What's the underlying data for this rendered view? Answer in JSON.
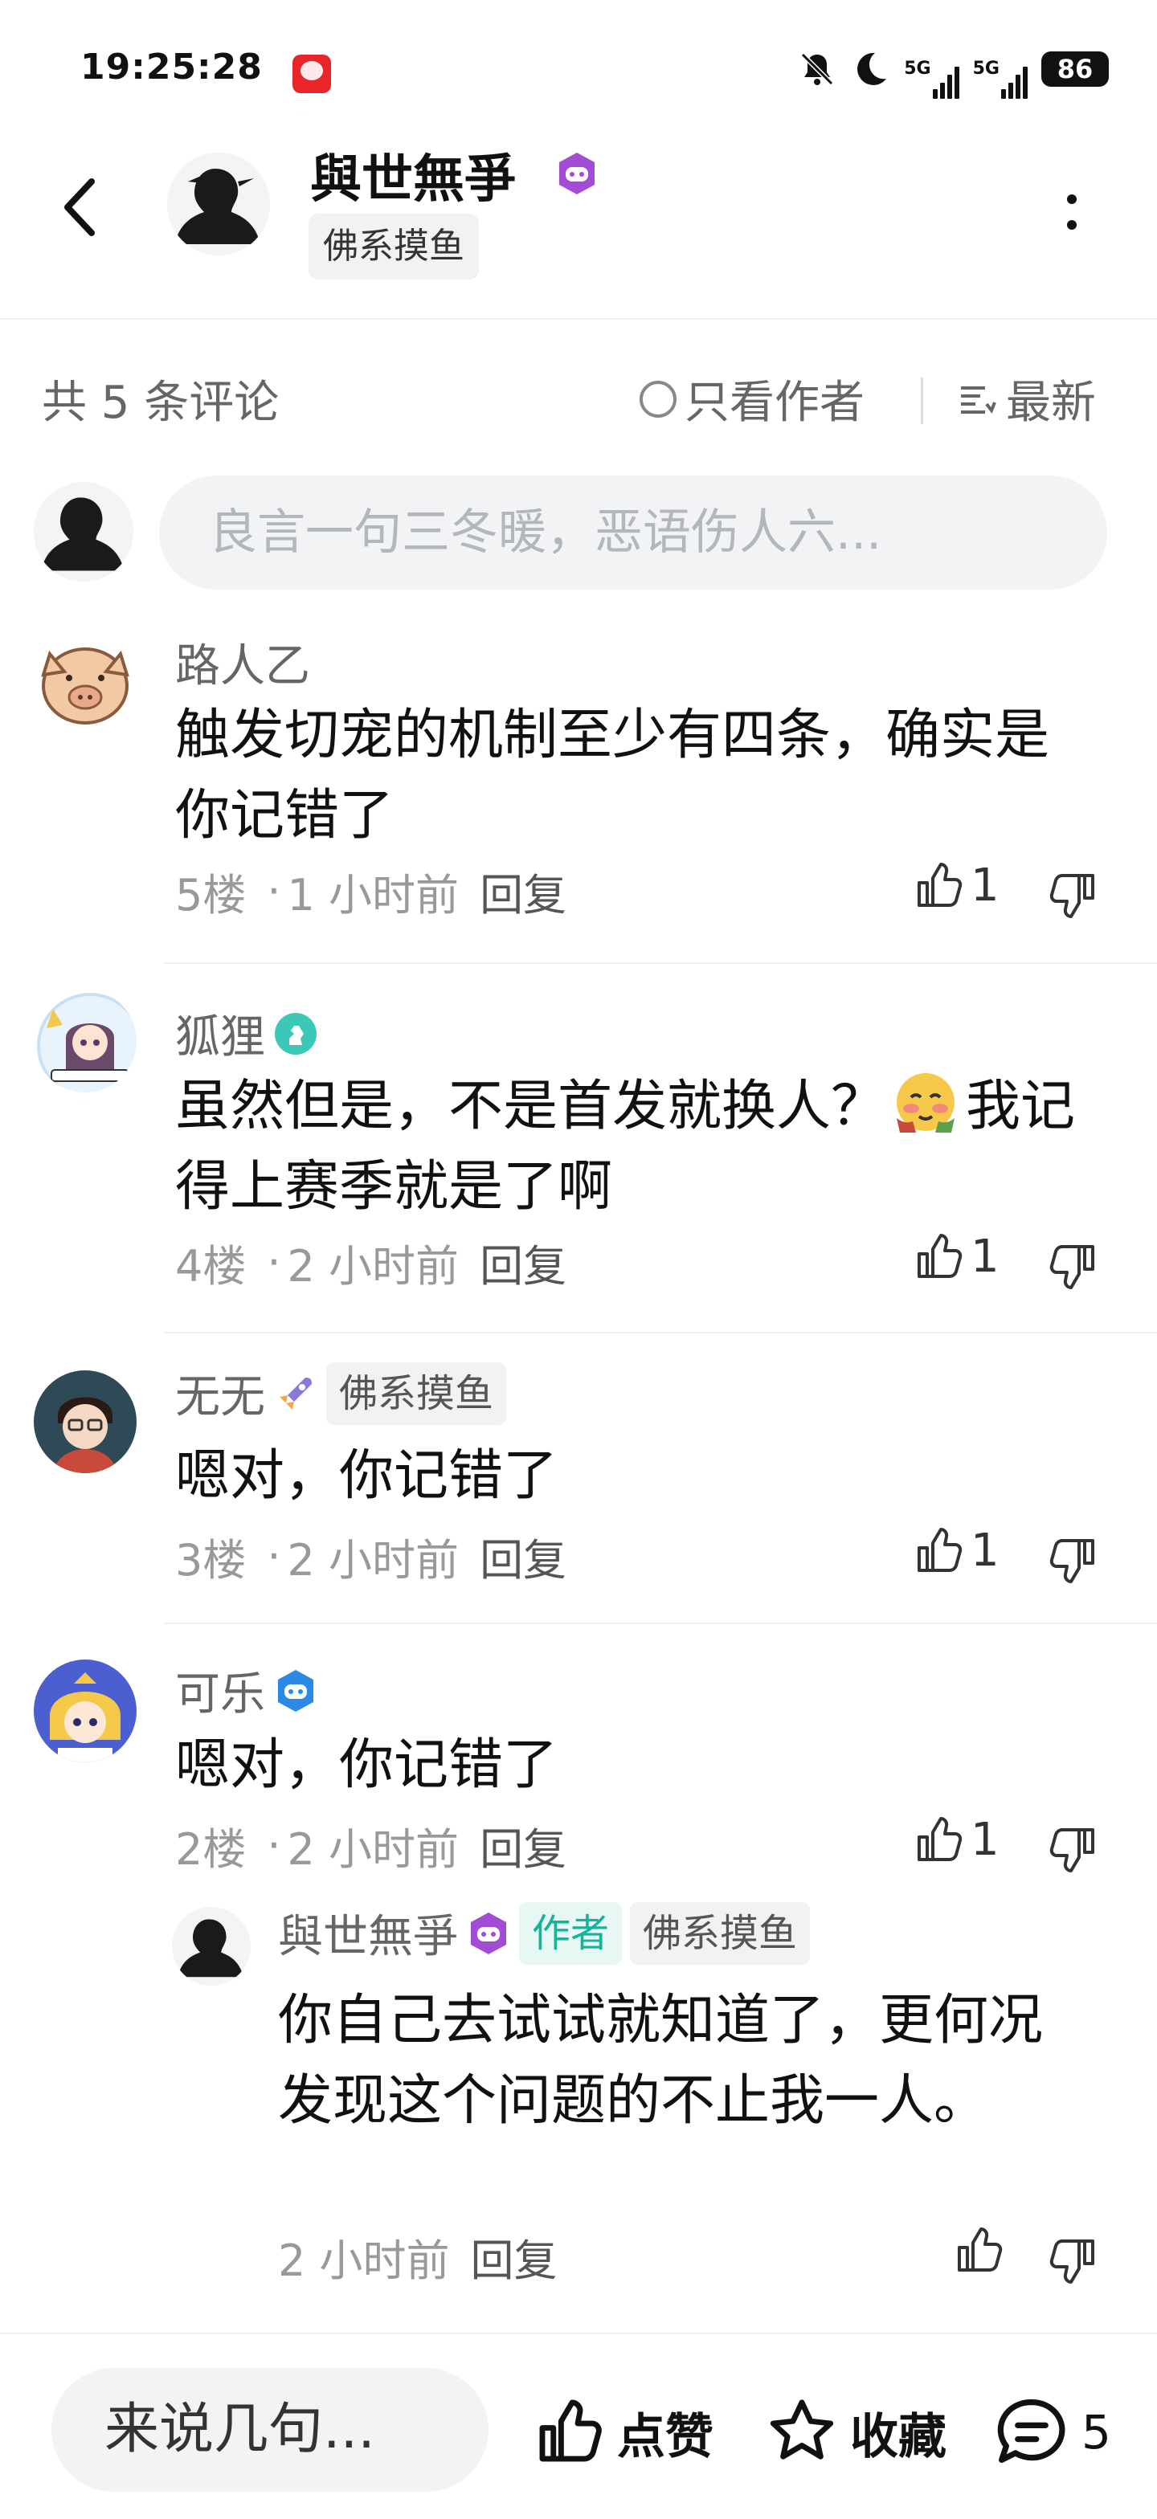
{
  "status_bar": {
    "time": "19:25:28",
    "network_1": "5G",
    "network_2": "5G",
    "battery": "86"
  },
  "header": {
    "author_name": "與世無爭",
    "author_tag": "佛系摸鱼",
    "icons": [
      "back-arrow-icon",
      "game-badge-icon",
      "more-icon"
    ]
  },
  "comments_header": {
    "count_label": "共 5 条评论",
    "only_author_label": "只看作者",
    "sort_label": "最新"
  },
  "comment_input": {
    "placeholder": "良言一句三冬暖，恶语伤人六..."
  },
  "comments": [
    {
      "name": "路人乙",
      "text": "触发切宠的机制至少有四条，确实是你记错了",
      "floor": "5楼",
      "time": "1 小时前",
      "reply_label": "回复",
      "likes": "1"
    },
    {
      "name": "狐狸",
      "text_before": "虽然但是，不是首发就换人？",
      "text_after": "我记得上赛季就是了啊",
      "floor": "4楼",
      "time": "2 小时前",
      "reply_label": "回复",
      "likes": "1"
    },
    {
      "name": "无无",
      "tag": "佛系摸鱼",
      "text": "嗯对，你记错了",
      "floor": "3楼",
      "time": "2 小时前",
      "reply_label": "回复",
      "likes": "1"
    },
    {
      "name": "可乐",
      "text": "嗯对，你记错了",
      "floor": "2楼",
      "time": "2 小时前",
      "reply_label": "回复",
      "likes": "1"
    }
  ],
  "reply": {
    "name": "與世無爭",
    "author_tag": "作者",
    "tag": "佛系摸鱼",
    "text": "你自己去试试就知道了，更何况发现这个问题的不止我一人。",
    "time": "2 小时前",
    "reply_label": "回复"
  },
  "bottom_bar": {
    "input_placeholder": "来说几句...",
    "like_label": "点赞",
    "collect_label": "收藏",
    "comment_count": "5"
  }
}
